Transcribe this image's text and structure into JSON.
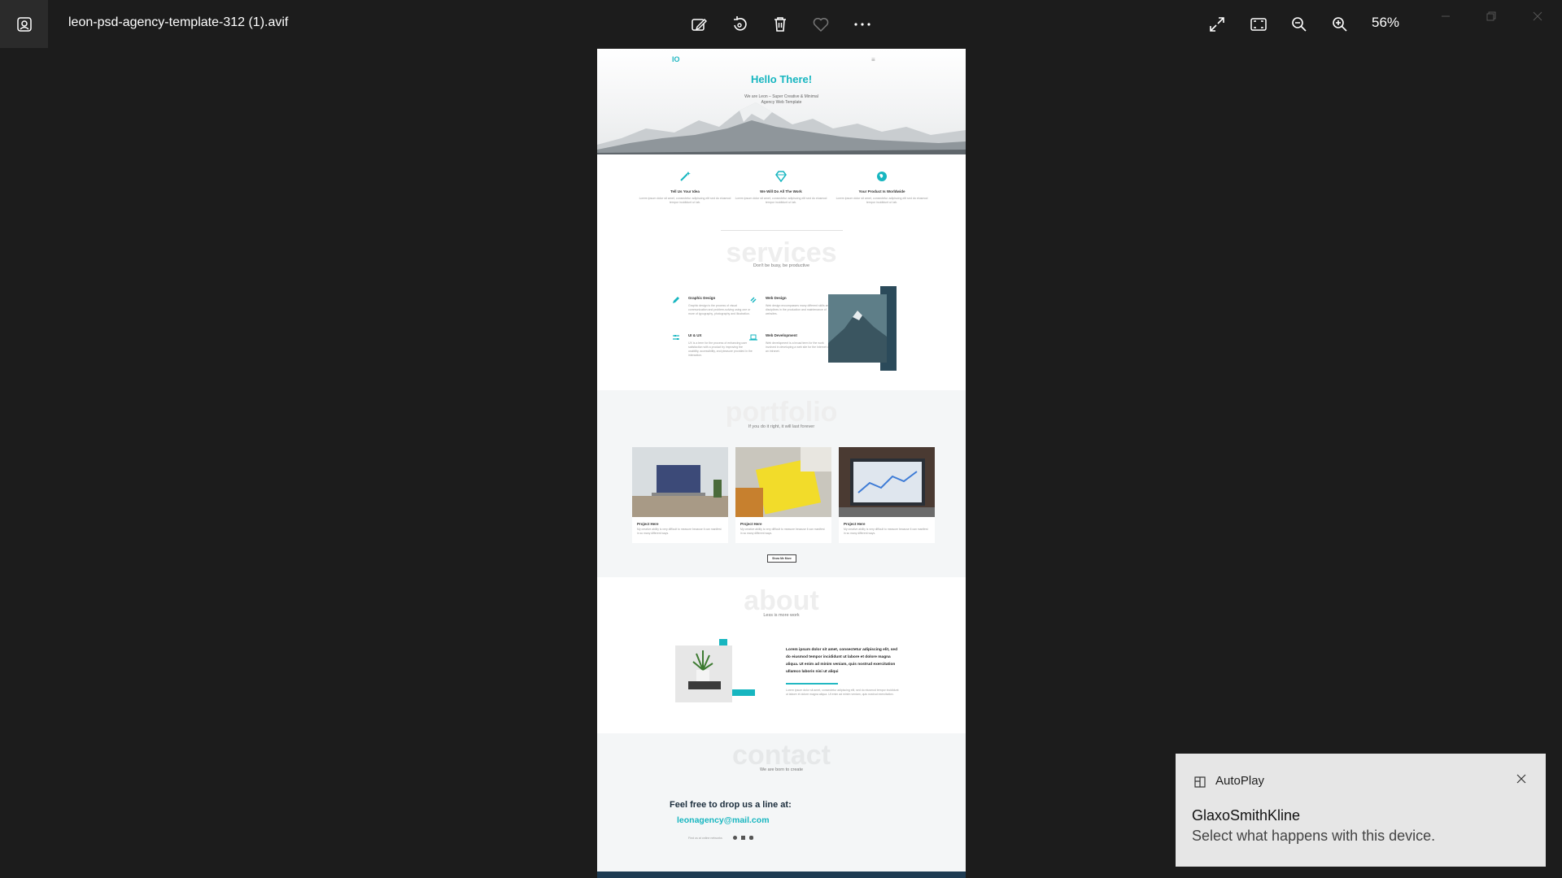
{
  "window": {
    "file_name": "leon-psd-agency-template-312 (1).avif",
    "zoom_level": "56%"
  },
  "toolbar": {
    "icons": [
      "edit-image-icon",
      "rotate-icon",
      "delete-icon",
      "favorite-icon",
      "more-options-icon"
    ],
    "right_icons": [
      "fullscreen-icon",
      "fit-to-window-icon",
      "zoom-out-icon",
      "zoom-in-icon"
    ]
  },
  "image": {
    "logo": "IO",
    "hero_title": "Hello There!",
    "hero_subtitle_line1": "We are Leon – Super Creative & Minimal",
    "hero_subtitle_line2": "Agency Web Template",
    "features": [
      {
        "icon": "magic-wand-icon",
        "title": "Tell Us Your Idea",
        "desc": "Lorem ipsum dolor sit amet, consectetur adipiscing elit sed do eiusmod tempor incididunt ut lab."
      },
      {
        "icon": "diamond-icon",
        "title": "We Will Do All The Work",
        "desc": "Lorem ipsum dolor sit amet, consectetur adipiscing elit sed do eiusmod tempor incididunt ut lab."
      },
      {
        "icon": "globe-icon",
        "title": "Your Product Is Worldwide",
        "desc": "Lorem ipsum dolor sit amet, consectetur adipiscing elit sed do eiusmod tempor incididunt ut lab."
      }
    ],
    "services": {
      "heading": "services",
      "tagline": "Don't be busy, be productive",
      "items": [
        {
          "icon": "pencil-icon",
          "title": "Graphic Design",
          "desc": "Graphic design is the process of visual communication and problem-solving using one or more of typography, photography and illustration."
        },
        {
          "icon": "link-icon",
          "title": "Web Design",
          "desc": "Web design encompasses many different skills and disciplines in the production and maintenance of websites."
        },
        {
          "icon": "sliders-icon",
          "title": "UI & UX",
          "desc": "UX is a term for the process of enhancing user satisfaction with a product by improving the usability, accessibility, and pleasure provided in the interaction."
        },
        {
          "icon": "laptop-icon",
          "title": "Web Development",
          "desc": "Web development is a broad term for the work involved in developing a web site for the Internet or an intranet."
        }
      ]
    },
    "portfolio": {
      "heading": "portfolio",
      "tagline": "If you do it right, it will last forever",
      "projects": [
        {
          "title": "Project Here",
          "desc": "My creative ability is very difficult to measure because it can manifest in so many different ways."
        },
        {
          "title": "Project Here",
          "desc": "My creative ability is very difficult to measure because it can manifest in so many different ways."
        },
        {
          "title": "Project Here",
          "desc": "My creative ability is very difficult to measure because it can manifest in so many different ways."
        }
      ],
      "more_button": "Show Me More"
    },
    "about": {
      "heading": "about",
      "tagline": "Less is more work",
      "bold_text": "Lorem ipsum dolor sit amet, consectetur adipiscing elit, sed do eiusmod tempor incididunt ut labore et dolore magna aliqua. Ut enim ad minim veniam, quis nostrud exercitation ullamco laboris nisi ut aliqui",
      "small_text": "Lorem ipsum dolor sit amet, consectetur adipiscing elit, sed do eiusmod tempor incididunt ut labore et dolore magna aliqua. Ut enim ad minim veniam, quis nostrud exercitation."
    },
    "contact": {
      "heading": "contact",
      "tagline": "We are born to create",
      "headline": "Feel free to drop us a line at:",
      "email": "leonagency@mail.com",
      "social_note": "Find us at online networks"
    }
  },
  "toast": {
    "app_name": "AutoPlay",
    "title": "GlaxoSmithKline",
    "message": "Select what happens with this device."
  }
}
